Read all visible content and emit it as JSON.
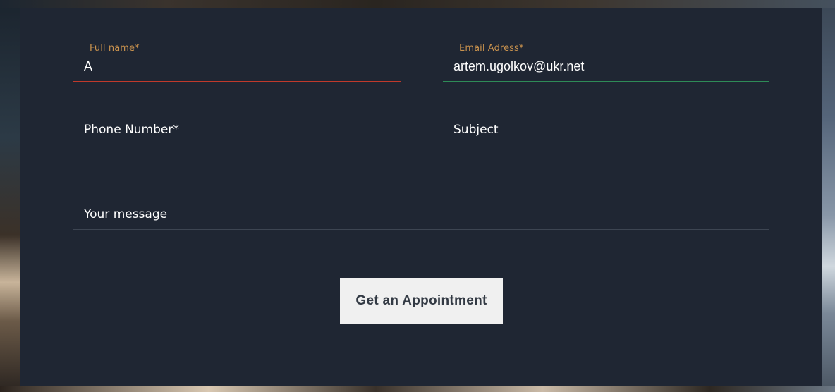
{
  "form": {
    "full_name": {
      "label": "Full name*",
      "value": "A"
    },
    "email": {
      "label": "Email Adress*",
      "value": "artem.ugolkov@ukr.net"
    },
    "phone": {
      "label": "Phone Number*"
    },
    "subject": {
      "label": "Subject"
    },
    "message": {
      "label": "Your message"
    },
    "submit_label": "Get an Appointment"
  },
  "colors": {
    "panel_bg": "#1f2633",
    "label_accent": "#c9924e",
    "error_line": "#c0392b",
    "valid_line": "#2e8b57",
    "button_bg": "#f0f0f0"
  }
}
